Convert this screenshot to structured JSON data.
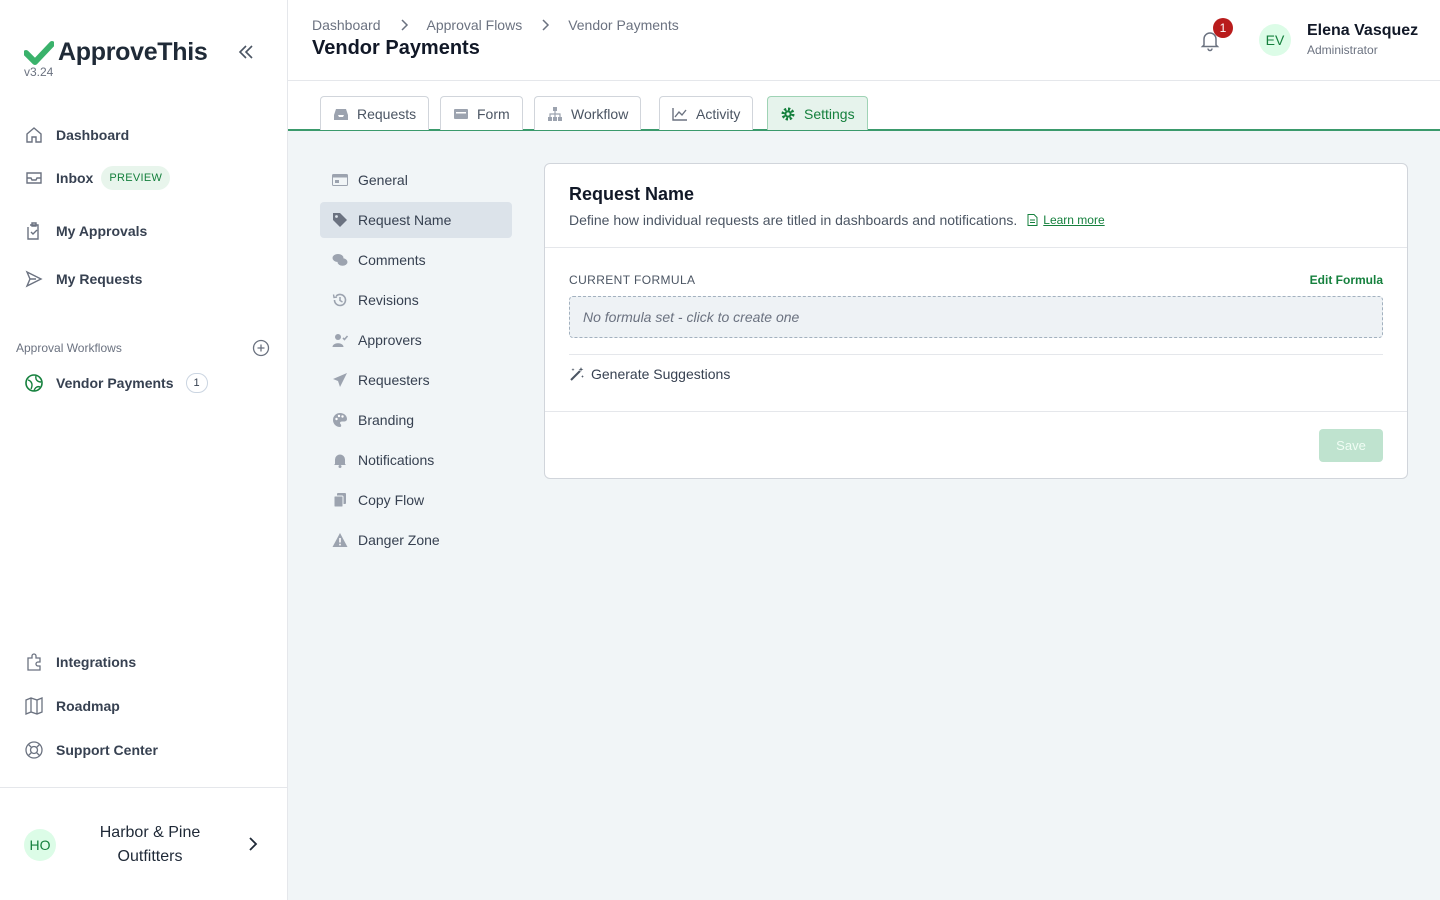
{
  "brand": {
    "name": "ApproveThis",
    "version": "v3.24"
  },
  "nav": {
    "dashboard": "Dashboard",
    "inbox": "Inbox",
    "inbox_badge": "PREVIEW",
    "my_approvals": "My Approvals",
    "my_requests": "My Requests"
  },
  "workflows": {
    "section_title": "Approval Workflows",
    "items": [
      {
        "label": "Vendor Payments",
        "count": "1"
      }
    ]
  },
  "bottom_nav": {
    "integrations": "Integrations",
    "roadmap": "Roadmap",
    "support": "Support Center"
  },
  "org": {
    "initials": "HO",
    "name": "Harbor & Pine Outfitters"
  },
  "header": {
    "breadcrumb": [
      "Dashboard",
      "Approval Flows",
      "Vendor Payments"
    ],
    "title": "Vendor Payments",
    "notification_count": "1",
    "user": {
      "initials": "EV",
      "name": "Elena Vasquez",
      "role": "Administrator"
    }
  },
  "tabs": [
    "Requests",
    "Form",
    "Workflow",
    "Activity",
    "Settings"
  ],
  "active_tab": "Settings",
  "settings_menu": [
    "General",
    "Request Name",
    "Comments",
    "Revisions",
    "Approvers",
    "Requesters",
    "Branding",
    "Notifications",
    "Copy Flow",
    "Danger Zone"
  ],
  "active_setting": "Request Name",
  "card": {
    "title": "Request Name",
    "description": "Define how individual requests are titled in dashboards and notifications.",
    "learn_more": "Learn more",
    "formula_label": "CURRENT FORMULA",
    "edit_formula": "Edit Formula",
    "formula_placeholder": "No formula set - click to create one",
    "generate": "Generate Suggestions",
    "save": "Save"
  },
  "colors": {
    "accent": "#15803d",
    "tab_border": "#3b9a6c",
    "badge_red": "#b91c1c"
  }
}
